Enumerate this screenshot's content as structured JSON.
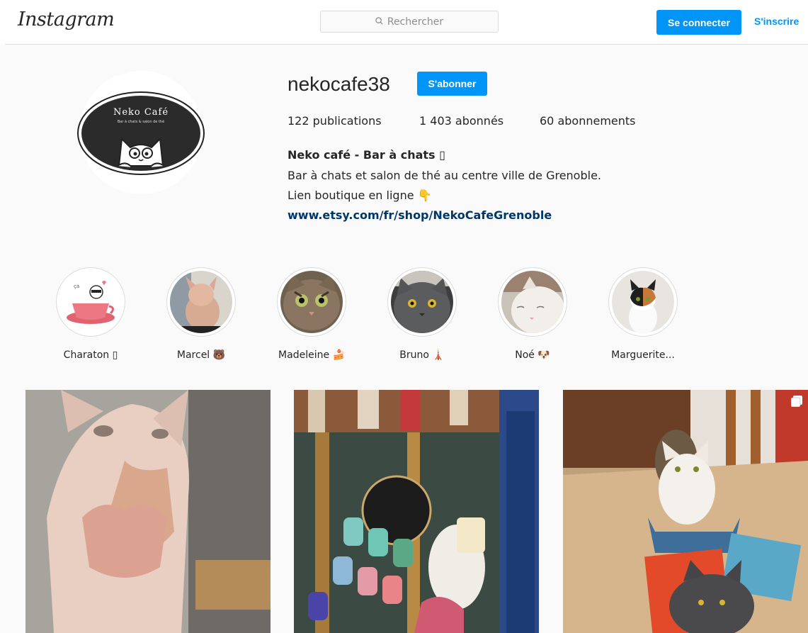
{
  "header": {
    "logo": "Instagram",
    "search_placeholder": "Rechercher",
    "login_label": "Se connecter",
    "signup_label": "S'inscrire"
  },
  "profile": {
    "username": "nekocafe38",
    "follow_label": "S'abonner",
    "avatar_text": "Neko Café",
    "avatar_subtext": "Bar à chats & salon de thé",
    "stats": {
      "posts_count": "122",
      "posts_label": "publications",
      "followers_count": "1 403",
      "followers_label": "abonnés",
      "following_count": "60",
      "following_label": "abonnements"
    },
    "bio": {
      "name": "Neko café - Bar à chats ▯",
      "line1": "Bar à chats et salon de thé au centre ville de Grenoble.",
      "line2": "Lien boutique en ligne 👇",
      "link": "www.etsy.com/fr/shop/NekoCafeGrenoble"
    }
  },
  "highlights": [
    {
      "label": "Charaton ▯"
    },
    {
      "label": "Marcel 🐻"
    },
    {
      "label": "Madeleine 🍰"
    },
    {
      "label": "Bruno 🗼"
    },
    {
      "label": "Noé 🐶"
    },
    {
      "label": "Marguerite..."
    }
  ],
  "posts": [
    {
      "icon": "photo"
    },
    {
      "icon": "photo"
    },
    {
      "icon": "carousel-icon"
    }
  ],
  "colors": {
    "accent": "#0095f6",
    "link": "#00376b",
    "background": "#fafafa",
    "border": "#dbdbdb"
  }
}
